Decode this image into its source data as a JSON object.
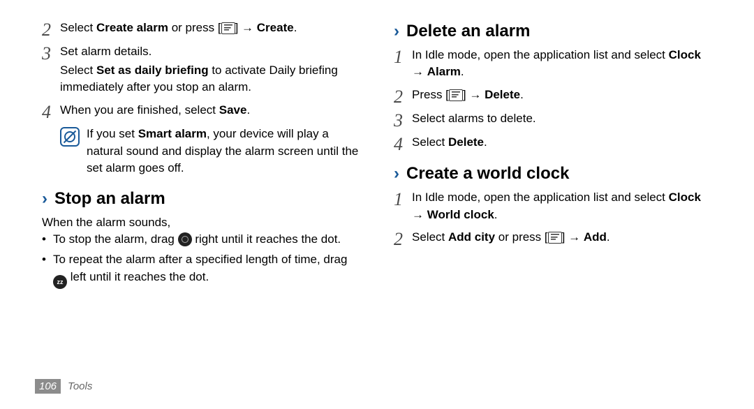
{
  "left": {
    "step2_a": "Select ",
    "step2_b": "Create alarm",
    "step2_c": " or press [",
    "step2_d": "] → ",
    "step2_e": "Create",
    "step2_f": ".",
    "step3_a": "Set alarm details.",
    "step3_sub_a": "Select ",
    "step3_sub_b": "Set as daily briefing",
    "step3_sub_c": " to activate Daily briefing immediately after you stop an alarm.",
    "step4_a": "When you are finished, select ",
    "step4_b": "Save",
    "step4_c": ".",
    "note_a": "If you set ",
    "note_b": "Smart alarm",
    "note_c": ", your device will play a natural sound and display the alarm screen until the set alarm goes off.",
    "heading_stop": "Stop an alarm",
    "stop_intro": "When the alarm sounds,",
    "bullet1_a": "To stop the alarm, drag ",
    "bullet1_b": " right until it reaches the dot.",
    "bullet2_a": "To repeat the alarm after a specified length of time, drag ",
    "bullet2_b": " left until it reaches the dot."
  },
  "right": {
    "heading_delete": "Delete an alarm",
    "d1_a": "In Idle mode, open the application list and select ",
    "d1_b": "Clock",
    "d1_c": " → ",
    "d1_d": "Alarm",
    "d1_e": ".",
    "d2_a": "Press [",
    "d2_b": "] → ",
    "d2_c": "Delete",
    "d2_d": ".",
    "d3": "Select alarms to delete.",
    "d4_a": "Select ",
    "d4_b": "Delete",
    "d4_c": ".",
    "heading_world": "Create a world clock",
    "w1_a": "In Idle mode, open the application list and select ",
    "w1_b": "Clock",
    "w1_c": " → ",
    "w1_d": "World clock",
    "w1_e": ".",
    "w2_a": "Select ",
    "w2_b": "Add city",
    "w2_c": " or press [",
    "w2_d": "] → ",
    "w2_e": "Add",
    "w2_f": "."
  },
  "nums": {
    "n1": "1",
    "n2": "2",
    "n3": "3",
    "n4": "4"
  },
  "glyphs": {
    "chevron": "›",
    "bullet": "•",
    "zz": "zz"
  },
  "footer": {
    "page": "106",
    "section": "Tools"
  }
}
